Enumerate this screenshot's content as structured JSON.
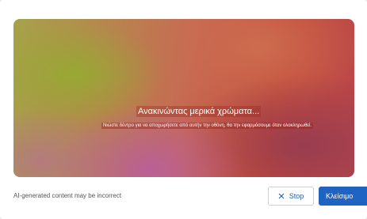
{
  "canvas": {
    "headline": "Ανακινώντας μερικά χρώματα...",
    "subline": "Νιώστε δέντρο για να αποχωρήσετε από αυτήν την οθόνη, θα την εφαρμόσουμε όταν ολοκληρωθεί."
  },
  "footer": {
    "disclaimer": "AI-generated content may be incorrect",
    "stop_label": "Stop",
    "close_label": "Κλείσιμο"
  },
  "icons": {
    "stop": "close-x-icon"
  },
  "colors": {
    "primary": "#1f63c3",
    "stop_text": "#1f5fb8"
  }
}
